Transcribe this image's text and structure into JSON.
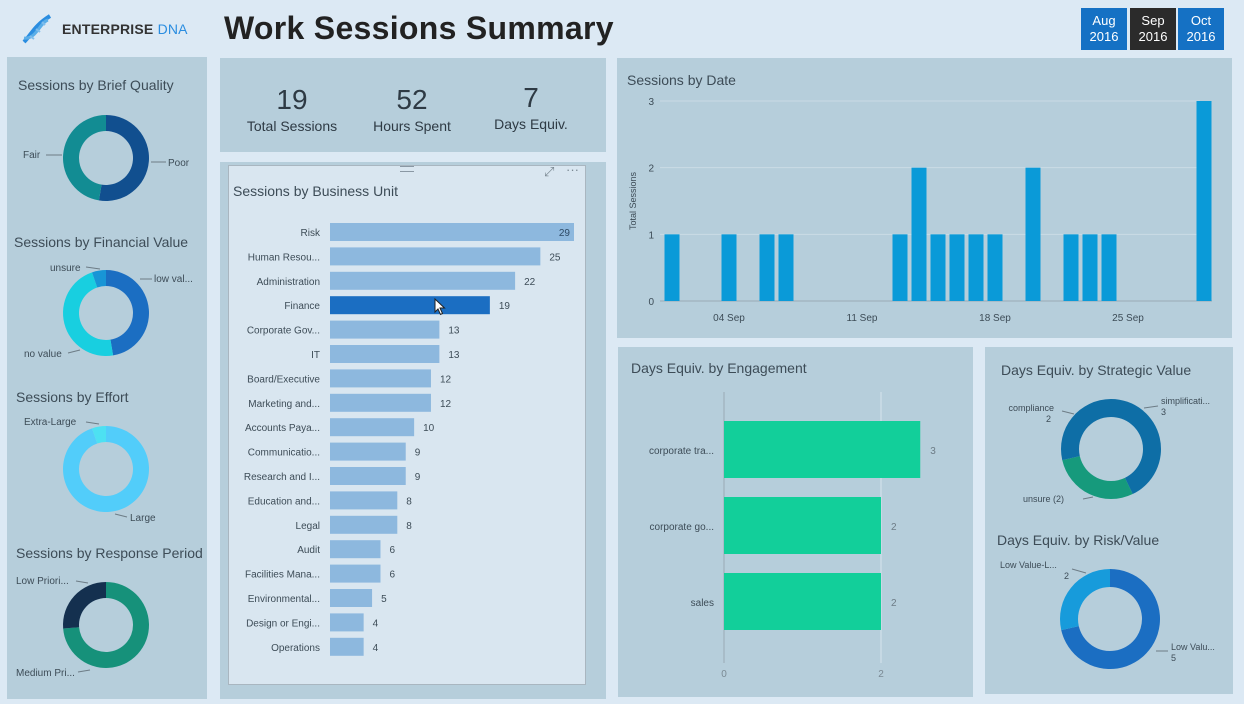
{
  "header": {
    "logo_main": "ENTERPRISE",
    "logo_accent": "DNA",
    "title": "Work Sessions Summary",
    "months": [
      {
        "label": "Aug",
        "year": "2016",
        "selected": false
      },
      {
        "label": "Sep",
        "year": "2016",
        "selected": true
      },
      {
        "label": "Oct",
        "year": "2016",
        "selected": false
      }
    ]
  },
  "kpis": [
    {
      "value": "19",
      "label": "Total Sessions"
    },
    {
      "value": "52",
      "label": "Hours Spent"
    },
    {
      "value": "7",
      "label": "Days Equiv."
    }
  ],
  "colors": {
    "selected_month": "#2b2b2b",
    "month": "#1571c4",
    "bar_light": "#8db8de",
    "bar_highlight": "#1b6ec2",
    "date_bar": "#0a9ad8",
    "engagement_bar": "#12cf9a"
  },
  "chart_data": [
    {
      "type": "pie",
      "title": "Sessions by Brief Quality",
      "donut": true,
      "slices": [
        {
          "label": "Poor",
          "value": 10,
          "color": "#114f8f"
        },
        {
          "label": "Fair",
          "value": 9,
          "color": "#128c93"
        }
      ]
    },
    {
      "type": "pie",
      "title": "Sessions by Financial Value",
      "donut": true,
      "slices": [
        {
          "label": "low val...",
          "value": 9,
          "color": "#1b6ec2"
        },
        {
          "label": "no value",
          "value": 9,
          "color": "#18cfe0"
        },
        {
          "label": "unsure",
          "value": 1,
          "color": "#1895d6"
        }
      ]
    },
    {
      "type": "pie",
      "title": "Sessions by Effort",
      "donut": true,
      "slices": [
        {
          "label": "Large",
          "value": 18,
          "color": "#52cdfa"
        },
        {
          "label": "Extra-Large",
          "value": 1,
          "color": "#4de1f2"
        }
      ]
    },
    {
      "type": "pie",
      "title": "Sessions by Response Period",
      "donut": true,
      "slices": [
        {
          "label": "Medium Pri...",
          "value": 14,
          "color": "#16917a"
        },
        {
          "label": "Low Priori...",
          "value": 5,
          "color": "#14304f"
        }
      ]
    },
    {
      "type": "bar",
      "orientation": "horizontal",
      "title": "Sessions by Business Unit",
      "categories": [
        "Risk",
        "Human Resou...",
        "Administration",
        "Finance",
        "Corporate Gov...",
        "IT",
        "Board/Executive",
        "Marketing and...",
        "Accounts Paya...",
        "Communicatio...",
        "Research and I...",
        "Education and...",
        "Legal",
        "Audit",
        "Facilities Mana...",
        "Environmental...",
        "Design or Engi...",
        "Operations"
      ],
      "values": [
        29,
        25,
        22,
        19,
        13,
        13,
        12,
        12,
        10,
        9,
        9,
        8,
        8,
        6,
        6,
        5,
        4,
        4
      ],
      "highlighted": "Finance",
      "xlim": [
        0,
        29
      ]
    },
    {
      "type": "bar",
      "title": "Sessions by Date",
      "ylabel": "Total Sessions",
      "x": [
        "01 Sep",
        "04 Sep",
        "06 Sep",
        "07 Sep",
        "13 Sep",
        "14 Sep",
        "15 Sep",
        "16 Sep",
        "17 Sep",
        "18 Sep",
        "20 Sep",
        "22 Sep",
        "23 Sep",
        "24 Sep",
        "29 Sep"
      ],
      "values": [
        1,
        1,
        1,
        1,
        1,
        2,
        1,
        1,
        1,
        1,
        2,
        1,
        1,
        1,
        3
      ],
      "x_ticks": [
        "04 Sep",
        "11 Sep",
        "18 Sep",
        "25 Sep"
      ],
      "y_ticks": [
        0,
        1,
        2,
        3
      ],
      "xlim": [
        "01 Sep",
        "29 Sep"
      ],
      "ylim": [
        0,
        3
      ],
      "grid": true
    },
    {
      "type": "bar",
      "orientation": "horizontal",
      "title": "Days Equiv. by Engagement",
      "categories": [
        "corporate tra...",
        "corporate go...",
        "sales"
      ],
      "values": [
        2.5,
        2,
        2
      ],
      "data_labels": [
        "3",
        "2",
        "2"
      ],
      "x_ticks": [
        0,
        2
      ],
      "xlim": [
        0,
        2.8
      ],
      "grid": true
    },
    {
      "type": "pie",
      "title": "Days Equiv. by Strategic Value",
      "donut": true,
      "slices": [
        {
          "label": "simplificati...",
          "value": 3,
          "display": "3",
          "color": "#0e6ea6"
        },
        {
          "label": "unsure (2)",
          "value": 2,
          "display": "",
          "color": "#169a7c"
        },
        {
          "label": "compliance",
          "value": 2,
          "display": "2",
          "color": "#0e6ea6"
        }
      ]
    },
    {
      "type": "pie",
      "title": "Days Equiv. by Risk/Value",
      "donut": true,
      "slices": [
        {
          "label": "Low Valu...",
          "value": 5,
          "display": "5",
          "color": "#1b6ec2"
        },
        {
          "label": "Low Value-L...",
          "value": 2,
          "display": "2",
          "color": "#179bdb"
        }
      ]
    }
  ]
}
